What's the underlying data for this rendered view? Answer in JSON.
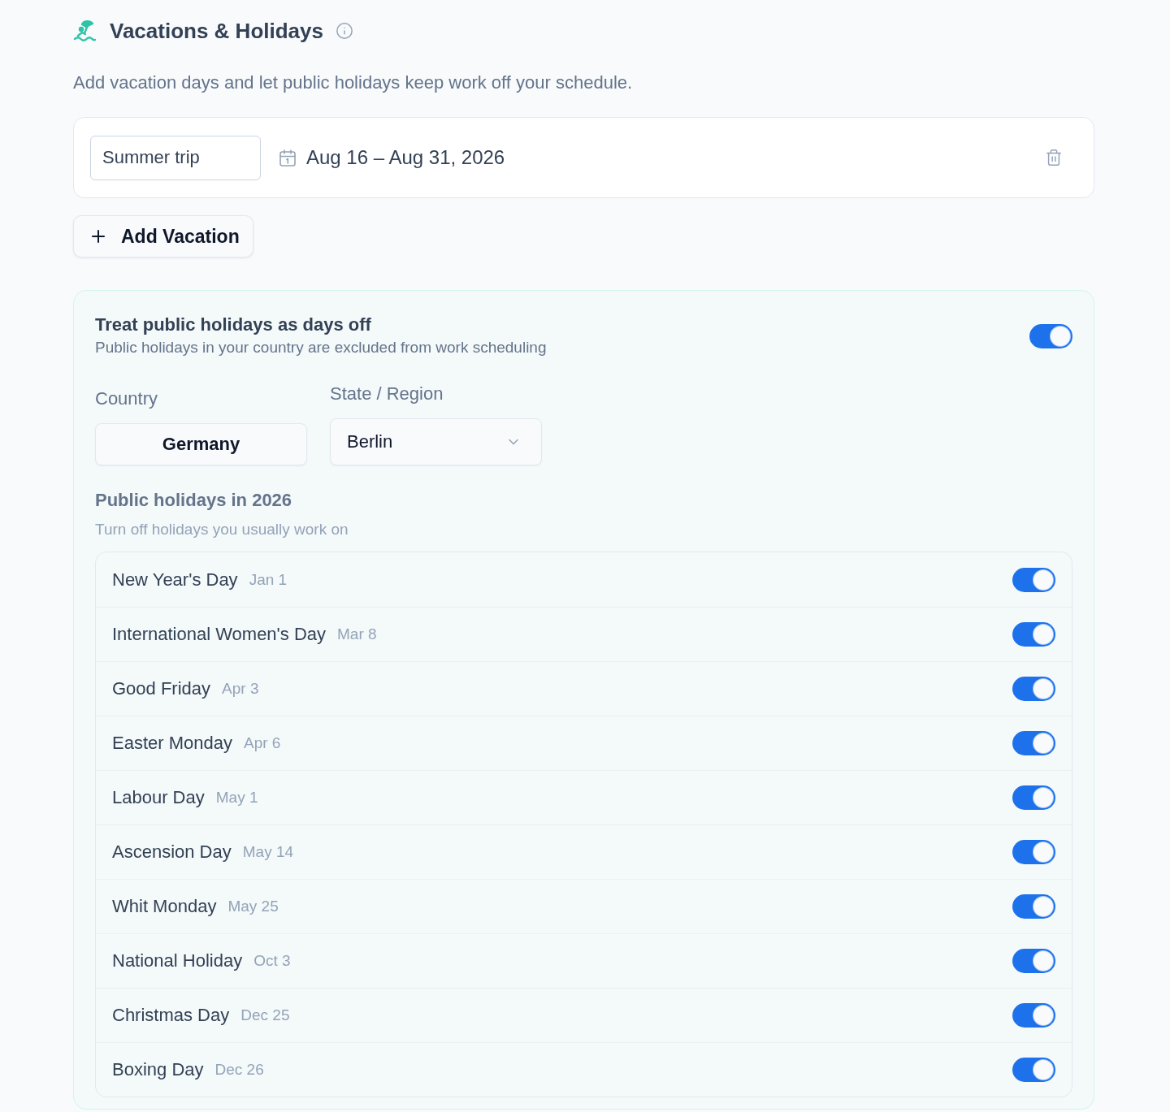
{
  "header": {
    "title": "Vacations & Holidays",
    "description": "Add vacation days and let public holidays keep work off your schedule."
  },
  "vacations": [
    {
      "name": "Summer trip",
      "dates": "Aug 16 – Aug 31, 2026"
    }
  ],
  "add_button": {
    "label": "Add Vacation"
  },
  "public_holidays": {
    "title": "Treat public holidays as days off",
    "subtitle": "Public holidays in your country are excluded from work scheduling",
    "on": true,
    "country": {
      "label": "Country",
      "value": "Germany"
    },
    "region": {
      "label": "State / Region",
      "value": "Berlin"
    },
    "list_title": "Public holidays in 2026",
    "list_hint": "Turn off holidays you usually work on",
    "holidays": [
      {
        "name": "New Year's Day",
        "date": "Jan 1",
        "on": true
      },
      {
        "name": "International Women's Day",
        "date": "Mar 8",
        "on": true
      },
      {
        "name": "Good Friday",
        "date": "Apr 3",
        "on": true
      },
      {
        "name": "Easter Monday",
        "date": "Apr 6",
        "on": true
      },
      {
        "name": "Labour Day",
        "date": "May 1",
        "on": true
      },
      {
        "name": "Ascension Day",
        "date": "May 14",
        "on": true
      },
      {
        "name": "Whit Monday",
        "date": "May 25",
        "on": true
      },
      {
        "name": "National Holiday",
        "date": "Oct 3",
        "on": true
      },
      {
        "name": "Christmas Day",
        "date": "Dec 25",
        "on": true
      },
      {
        "name": "Boxing Day",
        "date": "Dec 26",
        "on": true
      }
    ]
  }
}
